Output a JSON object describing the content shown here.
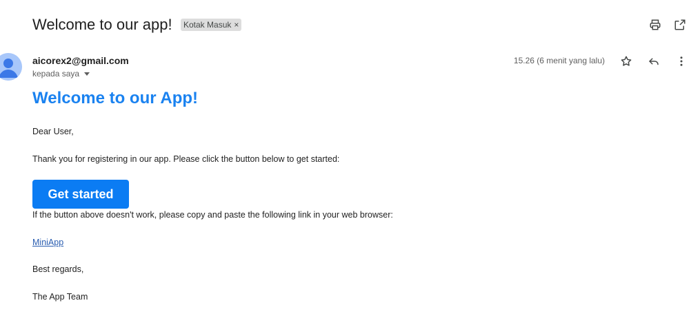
{
  "header": {
    "subject": "Welcome to our app!",
    "label": "Kotak Masuk",
    "label_close": "×",
    "print_icon": "print-icon",
    "open_in_new_icon": "open-in-new-window-icon"
  },
  "message": {
    "sender_email": "aicorex2@gmail.com",
    "recipient": "kepada saya",
    "timestamp": "15.26 (6 menit yang lalu)",
    "actions": [
      "star-icon",
      "reply-icon",
      "more-vert-icon"
    ]
  },
  "email_body": {
    "heading": "Welcome to our App!",
    "greeting": "Dear User,",
    "intro": "Thank you for registering in our app. Please click the button below to get started:",
    "button_label": "Get started",
    "fallback": "If the button above doesn't work, please copy and paste the following link in your web browser:",
    "link_text": "MiniApp",
    "closing": "Best regards,",
    "signature": "The App Team"
  },
  "colors": {
    "heading": "#1a82f0",
    "button_bg": "#0b7cf3",
    "avatar_bg": "#a8c7fa",
    "chip_bg": "#dddddd"
  }
}
